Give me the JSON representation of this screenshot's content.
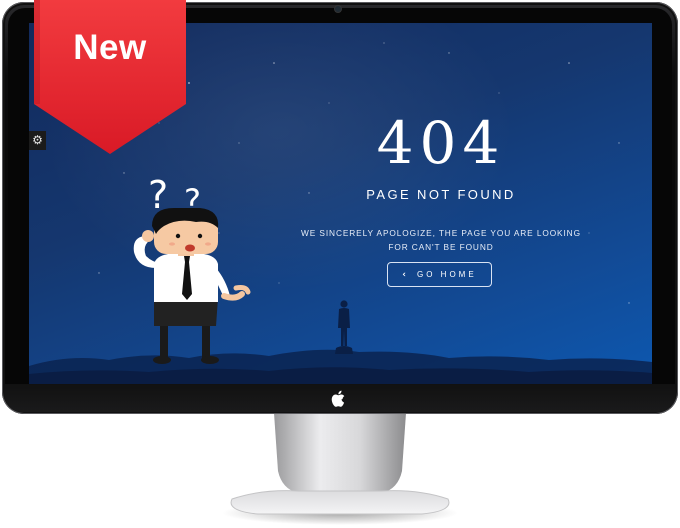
{
  "badge": {
    "label": "New"
  },
  "settings": {
    "icon": "gear-icon"
  },
  "error_page": {
    "code": "404",
    "title": "PAGE NOT FOUND",
    "message": "WE SINCERELY APOLOGIZE, THE PAGE YOU ARE LOOKING FOR CAN'T BE FOUND",
    "button_label": "GO HOME",
    "button_icon": "chevron-left-icon"
  },
  "colors": {
    "ribbon": "#e8222f",
    "screen_top": "#122a5c",
    "screen_bottom": "#0d58b0"
  }
}
